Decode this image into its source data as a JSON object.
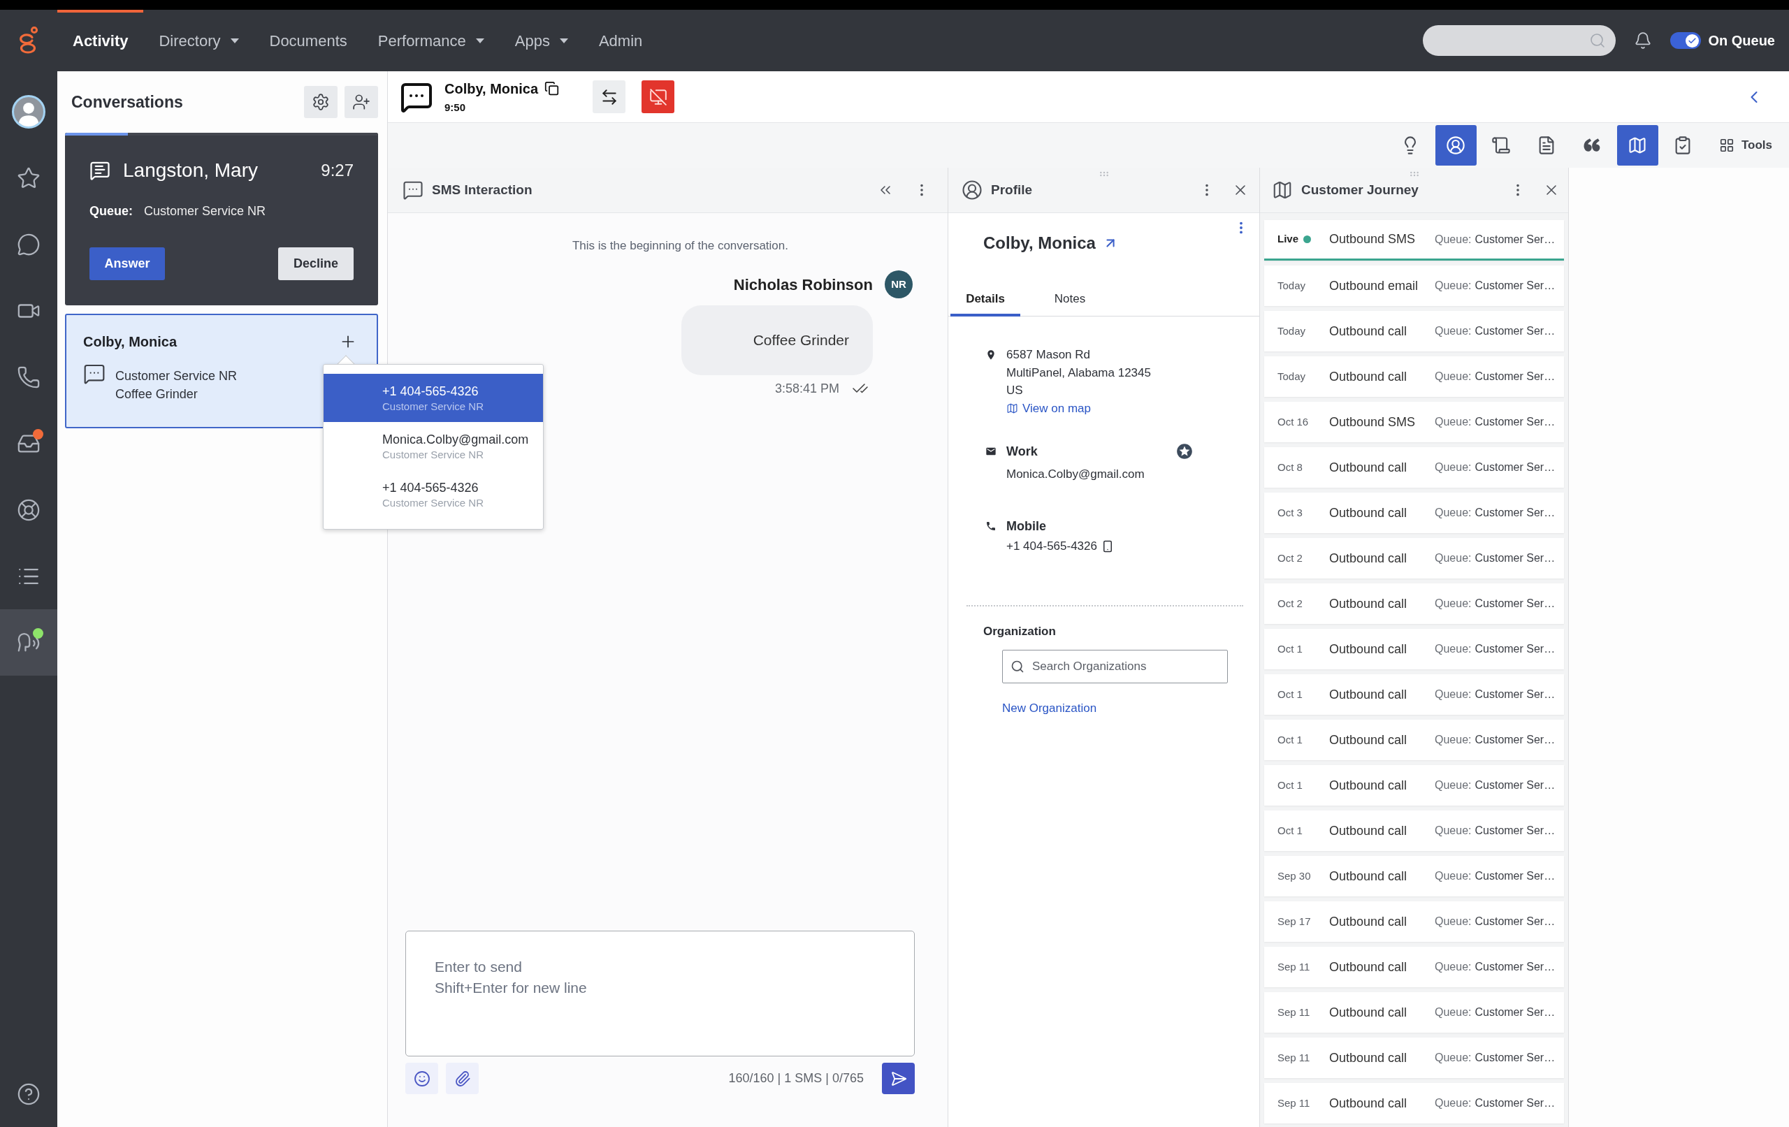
{
  "nav": {
    "items": [
      {
        "label": "Activity",
        "selected": true,
        "has_menu": false
      },
      {
        "label": "Directory",
        "selected": false,
        "has_menu": true
      },
      {
        "label": "Documents",
        "selected": false,
        "has_menu": false
      },
      {
        "label": "Performance",
        "selected": false,
        "has_menu": true
      },
      {
        "label": "Apps",
        "selected": false,
        "has_menu": true
      },
      {
        "label": "Admin",
        "selected": false,
        "has_menu": false
      }
    ],
    "queue_toggle": {
      "label": "On Queue",
      "on": true
    }
  },
  "sidebar": {
    "items": [
      {
        "selected": false
      },
      {
        "selected": false
      },
      {
        "selected": false
      },
      {
        "selected": false
      },
      {
        "selected": false
      },
      {
        "selected": false,
        "color": "#f26b3a"
      },
      {
        "selected": false
      },
      {
        "selected": false
      },
      {
        "selected": true,
        "color": "#8ee36a"
      },
      {
        "selected": false
      }
    ]
  },
  "conversations": {
    "title": "Conversations",
    "cards": [
      {
        "kind": "alerting",
        "selected": false,
        "name": "Langston, Mary",
        "time": "9:27",
        "level": 0.2,
        "queue_label": "Queue:",
        "queue": "Customer Service NR",
        "actions": [
          "Answer",
          "Decline"
        ]
      },
      {
        "kind": "active",
        "selected": true,
        "name": "Colby, Monica",
        "lines": [
          "Customer Service NR",
          "Coffee Grinder"
        ]
      }
    ],
    "contact_menu": {
      "items": [
        {
          "value": "+1 404-565-4326",
          "queue": "Customer Service NR",
          "selected": true
        },
        {
          "value": "Monica.Colby@gmail.com",
          "queue": "Customer Service NR",
          "selected": false
        },
        {
          "value": "+1 404-565-4326",
          "queue": "Customer Service NR",
          "selected": false
        }
      ]
    }
  },
  "interaction": {
    "name": "Colby, Monica",
    "duration": "9:50"
  },
  "toolbar": {
    "items": [
      {
        "selected": false
      },
      {
        "selected": true
      },
      {
        "selected": false
      },
      {
        "selected": false
      },
      {
        "selected": false
      },
      {
        "selected": true
      },
      {
        "selected": false
      }
    ],
    "tools_label": "Tools"
  },
  "sms_panel": {
    "title": "SMS Interaction",
    "start_note": "This is the beginning of the conversation.",
    "messages": [
      {
        "sender": "Nicholas Robinson",
        "initials": "NR",
        "text": "Coffee Grinder",
        "time": "3:58:41 PM",
        "read": true
      }
    ],
    "composer": {
      "placeholder": "Enter to send\nShift+Enter for new line",
      "counter": "160/160 | 1 SMS | 0/765"
    }
  },
  "profile_panel": {
    "title": "Profile",
    "name": "Colby, Monica",
    "tabs": [
      {
        "label": "Details",
        "selected": true
      },
      {
        "label": "Notes",
        "selected": false
      }
    ],
    "address": {
      "lines": [
        "6587 Mason Rd",
        "MultiPanel, Alabama 12345",
        "US"
      ],
      "map_link": "View on map"
    },
    "contacts": [
      {
        "kind": "email",
        "label": "Work",
        "value": "Monica.Colby@gmail.com",
        "primary": true
      },
      {
        "kind": "phone",
        "label": "Mobile",
        "value": "+1 404-565-4326",
        "primary": false
      }
    ],
    "organization": {
      "title": "Organization",
      "search_placeholder": "Search Organizations",
      "link": "New Organization"
    }
  },
  "journey_panel": {
    "title": "Customer Journey",
    "events": [
      {
        "date": "Live",
        "live": true,
        "title": "Outbound SMS",
        "queue_label": "Queue:",
        "queue": "Customer Ser…"
      },
      {
        "date": "Today",
        "live": false,
        "title": "Outbound email",
        "queue_label": "Queue:",
        "queue": "Customer Ser…"
      },
      {
        "date": "Today",
        "live": false,
        "title": "Outbound call",
        "queue_label": "Queue:",
        "queue": "Customer Ser…"
      },
      {
        "date": "Today",
        "live": false,
        "title": "Outbound call",
        "queue_label": "Queue:",
        "queue": "Customer Ser…"
      },
      {
        "date": "Oct 16",
        "live": false,
        "title": "Outbound SMS",
        "queue_label": "Queue:",
        "queue": "Customer Ser…"
      },
      {
        "date": "Oct 8",
        "live": false,
        "title": "Outbound call",
        "queue_label": "Queue:",
        "queue": "Customer Ser…"
      },
      {
        "date": "Oct 3",
        "live": false,
        "title": "Outbound call",
        "queue_label": "Queue:",
        "queue": "Customer Ser…"
      },
      {
        "date": "Oct 2",
        "live": false,
        "title": "Outbound call",
        "queue_label": "Queue:",
        "queue": "Customer Ser…"
      },
      {
        "date": "Oct 2",
        "live": false,
        "title": "Outbound call",
        "queue_label": "Queue:",
        "queue": "Customer Ser…"
      },
      {
        "date": "Oct 1",
        "live": false,
        "title": "Outbound call",
        "queue_label": "Queue:",
        "queue": "Customer Ser…"
      },
      {
        "date": "Oct 1",
        "live": false,
        "title": "Outbound call",
        "queue_label": "Queue:",
        "queue": "Customer Ser…"
      },
      {
        "date": "Oct 1",
        "live": false,
        "title": "Outbound call",
        "queue_label": "Queue:",
        "queue": "Customer Ser…"
      },
      {
        "date": "Oct 1",
        "live": false,
        "title": "Outbound call",
        "queue_label": "Queue:",
        "queue": "Customer Ser…"
      },
      {
        "date": "Oct 1",
        "live": false,
        "title": "Outbound call",
        "queue_label": "Queue:",
        "queue": "Customer Ser…"
      },
      {
        "date": "Sep 30",
        "live": false,
        "title": "Outbound call",
        "queue_label": "Queue:",
        "queue": "Customer Ser…"
      },
      {
        "date": "Sep 17",
        "live": false,
        "title": "Outbound call",
        "queue_label": "Queue:",
        "queue": "Customer Ser…"
      },
      {
        "date": "Sep 11",
        "live": false,
        "title": "Outbound call",
        "queue_label": "Queue:",
        "queue": "Customer Ser…"
      },
      {
        "date": "Sep 11",
        "live": false,
        "title": "Outbound call",
        "queue_label": "Queue:",
        "queue": "Customer Ser…"
      },
      {
        "date": "Sep 11",
        "live": false,
        "title": "Outbound call",
        "queue_label": "Queue:",
        "queue": "Customer Ser…"
      },
      {
        "date": "Sep 11",
        "live": false,
        "title": "Outbound call",
        "queue_label": "Queue:",
        "queue": "Customer Ser…"
      }
    ]
  }
}
